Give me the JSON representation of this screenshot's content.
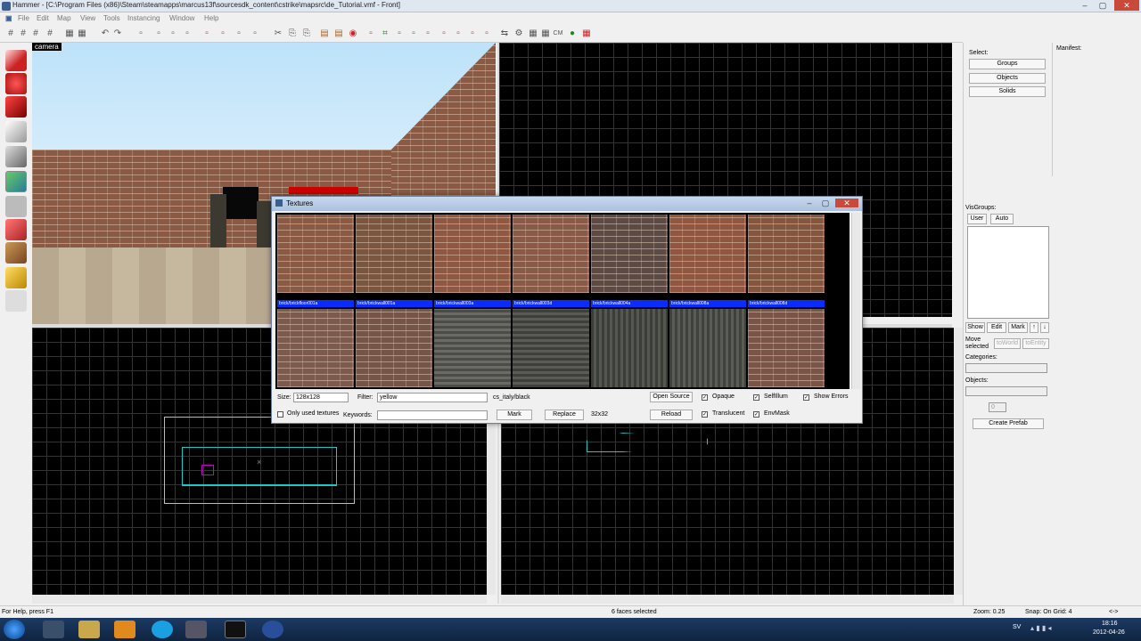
{
  "app": {
    "title": "Hammer - [C:\\Program Files (x86)\\Steam\\steamapps\\marcus13f\\sourcesdk_content\\cstrike\\mapsrc\\de_Tutorial.vmf - Front]"
  },
  "menu": [
    "File",
    "Edit",
    "Map",
    "View",
    "Tools",
    "Instancing",
    "Window",
    "Help"
  ],
  "viewports": {
    "camera_label": "camera"
  },
  "textures": {
    "title": "Textures",
    "row1": [
      "brick/brickfloor001a",
      "brick/brickwall001a",
      "brick/brickwall003a",
      "brick/brickwall003d",
      "brick/brickwall004a",
      "brick/brickwall008a",
      "brick/brickwall008d"
    ],
    "size_label": "Size:",
    "size_value": "128x128",
    "filter_label": "Filter:",
    "filter_value": "yellow",
    "selected_texture": "cs_italy/black",
    "open_source": "Open Source",
    "opaque": "Opaque",
    "selfillum": "SelfIllum",
    "show_errors": "Show Errors",
    "only_used": "Only used textures",
    "keywords_label": "Keywords:",
    "mark": "Mark",
    "replace": "Replace",
    "dims": "32x32",
    "reload": "Reload",
    "translucent": "Translucent",
    "envmask": "EnvMask"
  },
  "side": {
    "select_label": "Select:",
    "groups": "Groups",
    "objects": "Objects",
    "solids": "Solids",
    "visgroups": "VisGroups:",
    "user_tab": "User",
    "auto_tab": "Auto",
    "show": "Show",
    "edit": "Edit",
    "mark": "Mark",
    "move_selected": "Move selected",
    "to_world": "toWorld",
    "to_entity": "toEntity",
    "categories": "Categories:",
    "objects_label": "Objects:",
    "count": "0",
    "create_prefab": "Create Prefab"
  },
  "manifest": {
    "label": "Manifest:"
  },
  "status": {
    "help": "For Help, press F1",
    "faces": "6 faces selected",
    "zoom": "Zoom: 0.25",
    "snap": "Snap: On Grid: 4",
    "arrows": "<->"
  },
  "tray": {
    "lang": "SV",
    "time": "18:16",
    "date": "2012-04-26"
  }
}
